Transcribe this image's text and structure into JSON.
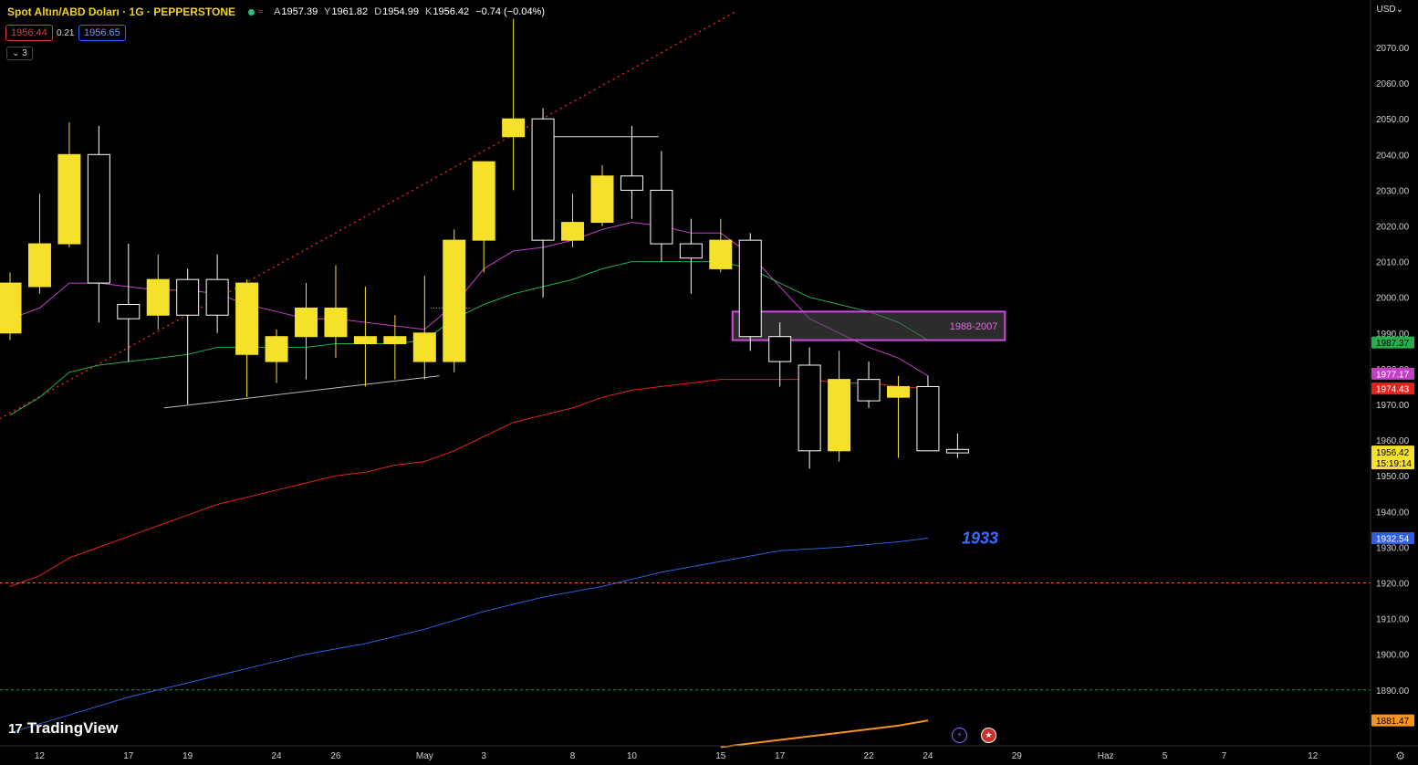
{
  "header": {
    "symbol": "Spot Altın/ABD Doları · 1G · PEPPERSTONE",
    "open_label": "A",
    "open": "1957.39",
    "high_label": "Y",
    "high": "1961.82",
    "low_label": "D",
    "low": "1954.99",
    "close_label": "K",
    "close": "1956.42",
    "change": "−0.74 (−0.04%)"
  },
  "trade": {
    "sell": "1956.44",
    "spread": "0.21",
    "buy": "1956.65"
  },
  "indicators_toggle": "3",
  "currency": "USD",
  "logo": "TradingView",
  "icons": {
    "settings": "gear-icon",
    "event1": "lightning-icon",
    "event2": "us-flag-icon",
    "collapse": "chevron-down-icon"
  },
  "colors": {
    "bull": "#f5e12a",
    "bear_border": "#ffffff",
    "ema_fast": "#c43ec8",
    "ema_mid": "#21b04b",
    "ema_slow": "#e8211d",
    "ema_long": "#2f5fe0",
    "ema_xlong": "#f6941e"
  },
  "annotations": {
    "zone_label": "1988-2007",
    "level_label": "1933"
  },
  "chart_data": {
    "type": "candlestick",
    "ylim": [
      1880,
      2080
    ],
    "y_ticks": [
      1890,
      1900,
      1910,
      1920,
      1930,
      1940,
      1950,
      1960,
      1970,
      1980,
      1990,
      2000,
      2010,
      2020,
      2030,
      2040,
      2050,
      2060,
      2070
    ],
    "x_ticks": [
      {
        "label": "12",
        "i": 1
      },
      {
        "label": "17",
        "i": 4
      },
      {
        "label": "19",
        "i": 6
      },
      {
        "label": "24",
        "i": 9
      },
      {
        "label": "26",
        "i": 11
      },
      {
        "label": "May",
        "i": 14
      },
      {
        "label": "3",
        "i": 16
      },
      {
        "label": "8",
        "i": 19
      },
      {
        "label": "10",
        "i": 21
      },
      {
        "label": "15",
        "i": 24
      },
      {
        "label": "17",
        "i": 26
      },
      {
        "label": "22",
        "i": 29
      },
      {
        "label": "24",
        "i": 31
      },
      {
        "label": "29",
        "i": 34
      },
      {
        "label": "Haz",
        "i": 37
      },
      {
        "label": "5",
        "i": 39
      },
      {
        "label": "7",
        "i": 41
      },
      {
        "label": "12",
        "i": 44
      }
    ],
    "candles": [
      {
        "o": 1990,
        "h": 2007,
        "l": 1988,
        "c": 2004
      },
      {
        "o": 2003,
        "h": 2029,
        "l": 2001,
        "c": 2015
      },
      {
        "o": 2015,
        "h": 2049,
        "l": 2014,
        "c": 2040
      },
      {
        "o": 2040,
        "h": 2048,
        "l": 1993,
        "c": 2004
      },
      {
        "o": 1998,
        "h": 2015,
        "l": 1982,
        "c": 1994
      },
      {
        "o": 1995,
        "h": 2012,
        "l": 1991,
        "c": 2005
      },
      {
        "o": 2005,
        "h": 2008,
        "l": 1970,
        "c": 1995
      },
      {
        "o": 2005,
        "h": 2012,
        "l": 1990,
        "c": 1995
      },
      {
        "o": 1984,
        "h": 2005,
        "l": 1972,
        "c": 2004
      },
      {
        "o": 1982,
        "h": 1991,
        "l": 1976,
        "c": 1989
      },
      {
        "o": 1989,
        "h": 2004,
        "l": 1977,
        "c": 1997
      },
      {
        "o": 1989,
        "h": 2009,
        "l": 1983,
        "c": 1997
      },
      {
        "o": 1987,
        "h": 2003,
        "l": 1975,
        "c": 1989
      },
      {
        "o": 1987,
        "h": 1995,
        "l": 1977,
        "c": 1989
      },
      {
        "o": 1982,
        "h": 2006,
        "l": 1977,
        "c": 1990
      },
      {
        "o": 1982,
        "h": 2019,
        "l": 1979,
        "c": 2016
      },
      {
        "o": 2016,
        "h": 2038,
        "l": 2007,
        "c": 2038
      },
      {
        "o": 2045,
        "h": 2078,
        "l": 2030,
        "c": 2050
      },
      {
        "o": 2050,
        "h": 2053,
        "l": 2000,
        "c": 2016
      },
      {
        "o": 2016,
        "h": 2029,
        "l": 2014,
        "c": 2021
      },
      {
        "o": 2021,
        "h": 2037,
        "l": 2020,
        "c": 2034
      },
      {
        "o": 2034,
        "h": 2048,
        "l": 2022,
        "c": 2030
      },
      {
        "o": 2030,
        "h": 2041,
        "l": 2010,
        "c": 2015
      },
      {
        "o": 2015,
        "h": 2022,
        "l": 2001,
        "c": 2011
      },
      {
        "o": 2008,
        "h": 2022,
        "l": 2007,
        "c": 2016
      },
      {
        "o": 2016,
        "h": 2018,
        "l": 1985,
        "c": 1989
      },
      {
        "o": 1989,
        "h": 1993,
        "l": 1975,
        "c": 1982
      },
      {
        "o": 1981,
        "h": 1986,
        "l": 1952,
        "c": 1957
      },
      {
        "o": 1957,
        "h": 1985,
        "l": 1954,
        "c": 1977
      },
      {
        "o": 1977,
        "h": 1982,
        "l": 1969,
        "c": 1971
      },
      {
        "o": 1972,
        "h": 1978,
        "l": 1955,
        "c": 1975
      },
      {
        "o": 1975,
        "h": 1978,
        "l": 1957,
        "c": 1957
      },
      {
        "o": 1957.39,
        "h": 1961.82,
        "l": 1954.99,
        "c": 1956.42
      }
    ],
    "series": [
      {
        "role": "ema_fast",
        "color": "#c43ec8",
        "points": [
          [
            0,
            1994
          ],
          [
            1,
            1997
          ],
          [
            2,
            2004
          ],
          [
            3,
            2004
          ],
          [
            4,
            2003
          ],
          [
            5,
            2002
          ],
          [
            6,
            2002
          ],
          [
            7,
            2001
          ],
          [
            8,
            1998
          ],
          [
            9,
            1996
          ],
          [
            10,
            1994
          ],
          [
            11,
            1994
          ],
          [
            12,
            1993
          ],
          [
            13,
            1992
          ],
          [
            14,
            1991
          ],
          [
            15,
            1998
          ],
          [
            16,
            2008
          ],
          [
            17,
            2013
          ],
          [
            18,
            2014
          ],
          [
            19,
            2016
          ],
          [
            20,
            2019
          ],
          [
            21,
            2021
          ],
          [
            22,
            2020
          ],
          [
            23,
            2018
          ],
          [
            24,
            2018
          ],
          [
            25,
            2012
          ],
          [
            26,
            2003
          ],
          [
            27,
            1994
          ],
          [
            28,
            1990
          ],
          [
            29,
            1986
          ],
          [
            30,
            1983
          ],
          [
            31,
            1978
          ]
        ]
      },
      {
        "role": "ema_mid",
        "color": "#21b04b",
        "points": [
          [
            0,
            1967
          ],
          [
            1,
            1972
          ],
          [
            2,
            1979
          ],
          [
            3,
            1981
          ],
          [
            4,
            1982
          ],
          [
            5,
            1983
          ],
          [
            6,
            1984
          ],
          [
            7,
            1986
          ],
          [
            8,
            1986
          ],
          [
            9,
            1986
          ],
          [
            10,
            1986
          ],
          [
            11,
            1987
          ],
          [
            12,
            1987
          ],
          [
            13,
            1987
          ],
          [
            14,
            1988
          ],
          [
            15,
            1994
          ],
          [
            16,
            1998
          ],
          [
            17,
            2001
          ],
          [
            18,
            2003
          ],
          [
            19,
            2005
          ],
          [
            20,
            2008
          ],
          [
            21,
            2010
          ],
          [
            22,
            2010
          ],
          [
            23,
            2010
          ],
          [
            24,
            2010
          ],
          [
            25,
            2008
          ],
          [
            26,
            2004
          ],
          [
            27,
            2000
          ],
          [
            28,
            1998
          ],
          [
            29,
            1996
          ],
          [
            30,
            1993
          ],
          [
            31,
            1988
          ]
        ]
      },
      {
        "role": "ema_slow",
        "color": "#e8211d",
        "points": [
          [
            0,
            1919
          ],
          [
            1,
            1922
          ],
          [
            2,
            1927
          ],
          [
            3,
            1930
          ],
          [
            4,
            1933
          ],
          [
            5,
            1936
          ],
          [
            6,
            1939
          ],
          [
            7,
            1942
          ],
          [
            8,
            1944
          ],
          [
            9,
            1946
          ],
          [
            10,
            1948
          ],
          [
            11,
            1950
          ],
          [
            12,
            1951
          ],
          [
            13,
            1953
          ],
          [
            14,
            1954
          ],
          [
            15,
            1957
          ],
          [
            16,
            1961
          ],
          [
            17,
            1965
          ],
          [
            18,
            1967
          ],
          [
            19,
            1969
          ],
          [
            20,
            1972
          ],
          [
            21,
            1974
          ],
          [
            22,
            1975
          ],
          [
            23,
            1976
          ],
          [
            24,
            1977
          ],
          [
            25,
            1977
          ],
          [
            26,
            1977
          ],
          [
            27,
            1977
          ],
          [
            28,
            1976
          ],
          [
            29,
            1976
          ],
          [
            30,
            1975
          ],
          [
            31,
            1974.43
          ]
        ]
      },
      {
        "role": "ema_long",
        "color": "#2f5fe0",
        "points": [
          [
            0,
            1878
          ],
          [
            2,
            1883
          ],
          [
            4,
            1888
          ],
          [
            6,
            1892
          ],
          [
            8,
            1896
          ],
          [
            10,
            1900
          ],
          [
            12,
            1903
          ],
          [
            14,
            1907
          ],
          [
            16,
            1912
          ],
          [
            18,
            1916
          ],
          [
            20,
            1919
          ],
          [
            22,
            1923
          ],
          [
            24,
            1926
          ],
          [
            26,
            1929
          ],
          [
            28,
            1930
          ],
          [
            30,
            1931.5
          ],
          [
            31,
            1932.54
          ]
        ]
      },
      {
        "role": "ema_xlong",
        "color": "#f6941e",
        "points": [
          [
            24,
            1874
          ],
          [
            26,
            1876
          ],
          [
            28,
            1878
          ],
          [
            30,
            1880
          ],
          [
            31,
            1881.47
          ]
        ]
      }
    ],
    "price_labels": [
      {
        "value": "1987.37",
        "y": 1987.37,
        "bg": "#21b04b",
        "fg": "#000"
      },
      {
        "value": "1977.17",
        "y": 1978.6,
        "bg": "#c43ec8",
        "fg": "#fff"
      },
      {
        "value": "1974.43",
        "y": 1974.43,
        "bg": "#e8211d",
        "fg": "#fff"
      },
      {
        "value": "1932.54",
        "y": 1932.54,
        "bg": "#2f5fe0",
        "fg": "#fff"
      },
      {
        "value": "1881.47",
        "y": 1881.47,
        "bg": "#f6941e",
        "fg": "#000"
      }
    ],
    "last_price": {
      "value": "1956.42",
      "countdown": "15:19:14",
      "y": 1956.42
    },
    "drawings": {
      "trendline_red": [
        [
          -1,
          1963
        ],
        [
          24.5,
          2080
        ]
      ],
      "trendline_white": [
        [
          5.2,
          1969
        ],
        [
          14.5,
          1978
        ]
      ],
      "hline_white": [
        [
          17.7,
          2045
        ],
        [
          21.9,
          2045
        ]
      ],
      "hline_dotted": [
        [
          14.2,
          1997
        ],
        [
          15.6,
          1997
        ]
      ],
      "zone": {
        "from": 1988,
        "to": 1996,
        "x0": 24.4,
        "x1": 33.6
      },
      "level_red_dashed": 1920,
      "level_green_dashed": 1890
    }
  }
}
